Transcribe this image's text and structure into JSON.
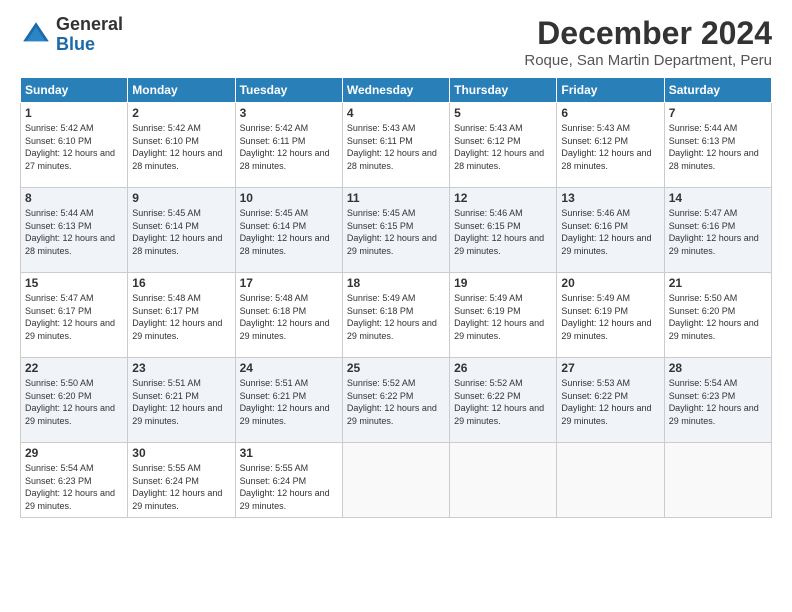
{
  "header": {
    "logo_general": "General",
    "logo_blue": "Blue",
    "month_title": "December 2024",
    "location": "Roque, San Martin Department, Peru"
  },
  "weekdays": [
    "Sunday",
    "Monday",
    "Tuesday",
    "Wednesday",
    "Thursday",
    "Friday",
    "Saturday"
  ],
  "weeks": [
    [
      {
        "day": "1",
        "sunrise": "5:42 AM",
        "sunset": "6:10 PM",
        "daylight": "12 hours and 27 minutes."
      },
      {
        "day": "2",
        "sunrise": "5:42 AM",
        "sunset": "6:10 PM",
        "daylight": "12 hours and 28 minutes."
      },
      {
        "day": "3",
        "sunrise": "5:42 AM",
        "sunset": "6:11 PM",
        "daylight": "12 hours and 28 minutes."
      },
      {
        "day": "4",
        "sunrise": "5:43 AM",
        "sunset": "6:11 PM",
        "daylight": "12 hours and 28 minutes."
      },
      {
        "day": "5",
        "sunrise": "5:43 AM",
        "sunset": "6:12 PM",
        "daylight": "12 hours and 28 minutes."
      },
      {
        "day": "6",
        "sunrise": "5:43 AM",
        "sunset": "6:12 PM",
        "daylight": "12 hours and 28 minutes."
      },
      {
        "day": "7",
        "sunrise": "5:44 AM",
        "sunset": "6:13 PM",
        "daylight": "12 hours and 28 minutes."
      }
    ],
    [
      {
        "day": "8",
        "sunrise": "5:44 AM",
        "sunset": "6:13 PM",
        "daylight": "12 hours and 28 minutes."
      },
      {
        "day": "9",
        "sunrise": "5:45 AM",
        "sunset": "6:14 PM",
        "daylight": "12 hours and 28 minutes."
      },
      {
        "day": "10",
        "sunrise": "5:45 AM",
        "sunset": "6:14 PM",
        "daylight": "12 hours and 28 minutes."
      },
      {
        "day": "11",
        "sunrise": "5:45 AM",
        "sunset": "6:15 PM",
        "daylight": "12 hours and 29 minutes."
      },
      {
        "day": "12",
        "sunrise": "5:46 AM",
        "sunset": "6:15 PM",
        "daylight": "12 hours and 29 minutes."
      },
      {
        "day": "13",
        "sunrise": "5:46 AM",
        "sunset": "6:16 PM",
        "daylight": "12 hours and 29 minutes."
      },
      {
        "day": "14",
        "sunrise": "5:47 AM",
        "sunset": "6:16 PM",
        "daylight": "12 hours and 29 minutes."
      }
    ],
    [
      {
        "day": "15",
        "sunrise": "5:47 AM",
        "sunset": "6:17 PM",
        "daylight": "12 hours and 29 minutes."
      },
      {
        "day": "16",
        "sunrise": "5:48 AM",
        "sunset": "6:17 PM",
        "daylight": "12 hours and 29 minutes."
      },
      {
        "day": "17",
        "sunrise": "5:48 AM",
        "sunset": "6:18 PM",
        "daylight": "12 hours and 29 minutes."
      },
      {
        "day": "18",
        "sunrise": "5:49 AM",
        "sunset": "6:18 PM",
        "daylight": "12 hours and 29 minutes."
      },
      {
        "day": "19",
        "sunrise": "5:49 AM",
        "sunset": "6:19 PM",
        "daylight": "12 hours and 29 minutes."
      },
      {
        "day": "20",
        "sunrise": "5:49 AM",
        "sunset": "6:19 PM",
        "daylight": "12 hours and 29 minutes."
      },
      {
        "day": "21",
        "sunrise": "5:50 AM",
        "sunset": "6:20 PM",
        "daylight": "12 hours and 29 minutes."
      }
    ],
    [
      {
        "day": "22",
        "sunrise": "5:50 AM",
        "sunset": "6:20 PM",
        "daylight": "12 hours and 29 minutes."
      },
      {
        "day": "23",
        "sunrise": "5:51 AM",
        "sunset": "6:21 PM",
        "daylight": "12 hours and 29 minutes."
      },
      {
        "day": "24",
        "sunrise": "5:51 AM",
        "sunset": "6:21 PM",
        "daylight": "12 hours and 29 minutes."
      },
      {
        "day": "25",
        "sunrise": "5:52 AM",
        "sunset": "6:22 PM",
        "daylight": "12 hours and 29 minutes."
      },
      {
        "day": "26",
        "sunrise": "5:52 AM",
        "sunset": "6:22 PM",
        "daylight": "12 hours and 29 minutes."
      },
      {
        "day": "27",
        "sunrise": "5:53 AM",
        "sunset": "6:22 PM",
        "daylight": "12 hours and 29 minutes."
      },
      {
        "day": "28",
        "sunrise": "5:54 AM",
        "sunset": "6:23 PM",
        "daylight": "12 hours and 29 minutes."
      }
    ],
    [
      {
        "day": "29",
        "sunrise": "5:54 AM",
        "sunset": "6:23 PM",
        "daylight": "12 hours and 29 minutes."
      },
      {
        "day": "30",
        "sunrise": "5:55 AM",
        "sunset": "6:24 PM",
        "daylight": "12 hours and 29 minutes."
      },
      {
        "day": "31",
        "sunrise": "5:55 AM",
        "sunset": "6:24 PM",
        "daylight": "12 hours and 29 minutes."
      },
      null,
      null,
      null,
      null
    ]
  ],
  "labels": {
    "sunrise_prefix": "Sunrise: ",
    "sunset_prefix": "Sunset: ",
    "daylight_prefix": "Daylight: "
  }
}
